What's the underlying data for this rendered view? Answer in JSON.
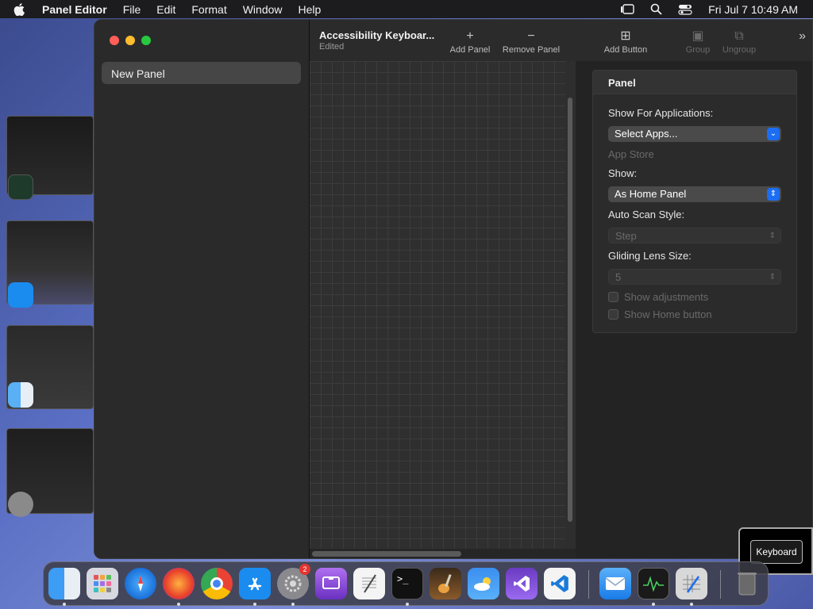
{
  "menubar": {
    "app_name": "Panel Editor",
    "menus": [
      "File",
      "Edit",
      "Format",
      "Window",
      "Help"
    ],
    "clock": "Fri Jul 7  10:49 AM"
  },
  "toolbar": {
    "doc_title": "Accessibility Keyboar...",
    "doc_status": "Edited",
    "add_panel": "Add Panel",
    "remove_panel": "Remove Panel",
    "add_button": "Add Button",
    "group": "Group",
    "ungroup": "Ungroup"
  },
  "sidebar": {
    "items": [
      {
        "label": "New Panel"
      }
    ]
  },
  "inspector": {
    "title": "Panel",
    "show_for_apps_label": "Show For Applications:",
    "show_for_apps_value": "Select Apps...",
    "app_store_hint": "App Store",
    "show_label": "Show:",
    "show_value": "As Home Panel",
    "auto_scan_label": "Auto Scan Style:",
    "auto_scan_value": "Step",
    "gliding_lens_label": "Gliding Lens Size:",
    "gliding_lens_value": "5",
    "show_adjustments": "Show adjustments",
    "show_home_button": "Show Home button"
  },
  "keyboard_tooltip": "Keyboard",
  "dock": {
    "settings_badge": "2",
    "apps": [
      "Finder",
      "Launchpad",
      "Safari",
      "Firefox",
      "Chrome",
      "App Store",
      "System Settings",
      "Notchmeister",
      "TextEdit",
      "Terminal",
      "GarageBand",
      "Weather",
      "Visual Studio",
      "VS Code",
      "Mail",
      "Activity Monitor",
      "Panel Editor",
      "Trash"
    ]
  },
  "colors": {
    "accent": "#1b6ef3",
    "close": "#ff5f57",
    "minimize": "#febc2e",
    "zoom": "#28c840"
  }
}
